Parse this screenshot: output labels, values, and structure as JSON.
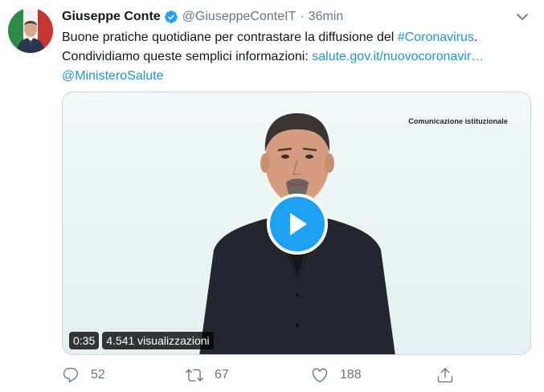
{
  "tweet": {
    "author_name": "Giuseppe Conte",
    "handle": "@GiuseppeConteIT",
    "separator": "·",
    "time": "36min",
    "text_line1_plain": "Buone pratiche quotidiane per contrastare la diffusione del ",
    "hashtag": "#Coronavirus",
    "text_line1_end": ".",
    "text_line2_plain": "Condividiamo queste semplici informazioni: ",
    "link": "salute.gov.it/nuovocoronavir…",
    "mention": "@MinisteroSalute"
  },
  "media": {
    "caption": "Comunicazione istituzionale",
    "duration": "0:35",
    "views": "4.541 visualizzazioni"
  },
  "actions": {
    "replies": "52",
    "retweets": "67",
    "likes": "188"
  },
  "icons": {
    "verified": "verified-badge-icon",
    "menu": "chevron-down-icon",
    "reply": "reply-icon",
    "retweet": "retweet-icon",
    "like": "heart-icon",
    "share": "share-icon",
    "play": "play-icon"
  },
  "colors": {
    "link": "#1b95e0",
    "verified": "#1da1f2",
    "secondary": "#657786",
    "play_button": "#1da1f2"
  }
}
